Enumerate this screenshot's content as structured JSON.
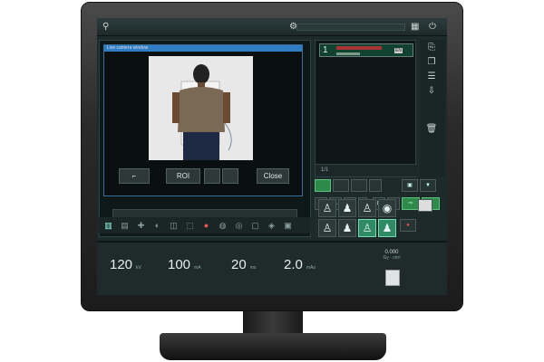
{
  "topbar": {
    "patient_icon": "patient-icon",
    "center_icon": "settings-gear-icon",
    "end_icon": "power-icon"
  },
  "viewer": {
    "dialog_title": "Live camera window",
    "buttons": {
      "curve": "⌐",
      "roi": "ROI",
      "close": "Close"
    }
  },
  "exam_list": {
    "item": {
      "index": "1",
      "label_top": "",
      "label_bottom": "",
      "badge": "EN"
    },
    "footer_page": "1/1"
  },
  "exposure": {
    "kv": {
      "value": "120",
      "unit": "kV"
    },
    "ma": {
      "value": "100",
      "unit": "mA"
    },
    "ms": {
      "value": "20",
      "unit": "ms"
    },
    "mas": {
      "value": "2.0",
      "unit": "mAs"
    },
    "dose": {
      "value": "0.000",
      "unit": "Gy · cm²"
    }
  },
  "colors": {
    "accent_green": "#2f8a66",
    "title_blue": "#2f7ec4",
    "bg": "#1d2a2a"
  }
}
